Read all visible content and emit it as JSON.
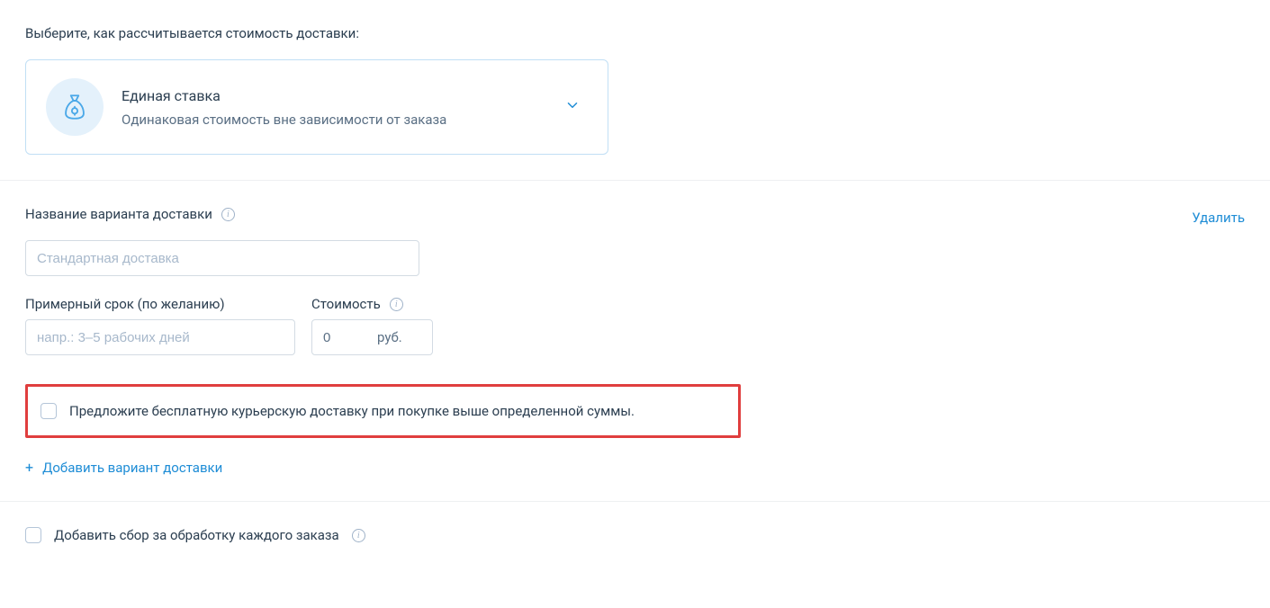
{
  "header": {
    "prompt": "Выберите, как рассчитывается стоимость доставки:"
  },
  "rate_card": {
    "title": "Единая ставка",
    "description": "Одинаковая стоимость вне зависимости от заказа"
  },
  "variant": {
    "name_label": "Название варианта доставки",
    "delete_label": "Удалить",
    "name_placeholder": "Стандартная доставка",
    "time_label": "Примерный срок (по желанию)",
    "time_placeholder": "напр.: 3–5 рабочих дней",
    "cost_label": "Стоимость",
    "cost_value": "0",
    "cost_currency": "руб.",
    "free_offer_label": "Предложите бесплатную курьерскую доставку при покупке выше определенной суммы.",
    "add_variant_label": "Добавить вариант доставки"
  },
  "handling": {
    "label": "Добавить сбор за обработку каждого заказа"
  }
}
